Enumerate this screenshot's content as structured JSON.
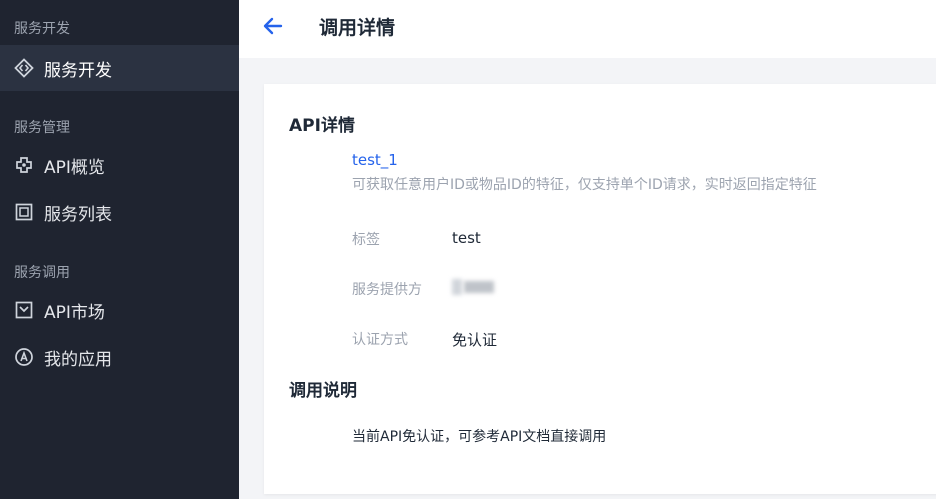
{
  "sidebar": {
    "groups": [
      {
        "title": "服务开发",
        "items": [
          {
            "label": "服务开发",
            "icon": "code-icon",
            "active": true
          }
        ]
      },
      {
        "title": "服务管理",
        "items": [
          {
            "label": "API概览",
            "icon": "puzzle-icon"
          },
          {
            "label": "服务列表",
            "icon": "list-icon"
          }
        ]
      },
      {
        "title": "服务调用",
        "items": [
          {
            "label": "API市场",
            "icon": "store-icon"
          },
          {
            "label": "我的应用",
            "icon": "app-icon"
          }
        ]
      }
    ]
  },
  "header": {
    "title": "调用详情",
    "back_icon": "arrow-left-icon"
  },
  "detail": {
    "section_title": "API详情",
    "api_name": "test_1",
    "api_description": "可获取任意用户ID或物品ID的特征，仅支持单个ID请求，实时返回指定特征",
    "fields": [
      {
        "label": "标签",
        "value": "test"
      },
      {
        "label": "服务提供方",
        "value": ""
      },
      {
        "label": "认证方式",
        "value": "免认证"
      }
    ]
  },
  "usage": {
    "section_title": "调用说明",
    "text": "当前API免认证，可参考API文档直接调用"
  },
  "colors": {
    "sidebar_bg": "#1f2430",
    "active_item_bg": "#2b3241",
    "accent": "#2563eb"
  }
}
